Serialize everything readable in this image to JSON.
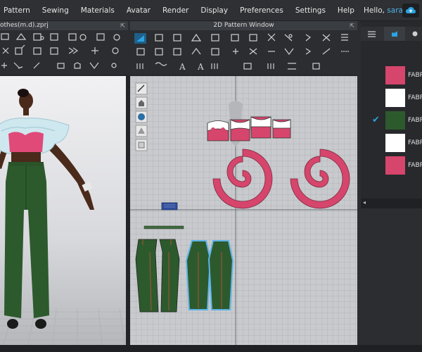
{
  "menu": {
    "items": [
      "Pattern",
      "Sewing",
      "Materials",
      "Avatar",
      "Render",
      "Display",
      "Preferences",
      "Settings",
      "Help"
    ],
    "greeting": "Hello,",
    "user": "sara"
  },
  "panels": {
    "view3d_title": "othes(m.d).zprj",
    "view2d_title": "2D Pattern Window"
  },
  "fabrics": [
    {
      "label": "FABR",
      "color": "#d6456c",
      "selected": false
    },
    {
      "label": "FABR",
      "color": "#ffffff",
      "selected": false
    },
    {
      "label": "FABR",
      "color": "#2d5a2d",
      "selected": true
    },
    {
      "label": "FABR",
      "color": "#ffffff",
      "selected": false
    },
    {
      "label": "FABR",
      "color": "#d6456c",
      "selected": false
    }
  ],
  "colors": {
    "accent": "#2ba3e0",
    "pink_fabric": "#d6456c",
    "green_fabric": "#2d5a2d",
    "background": "#2b2d30"
  }
}
